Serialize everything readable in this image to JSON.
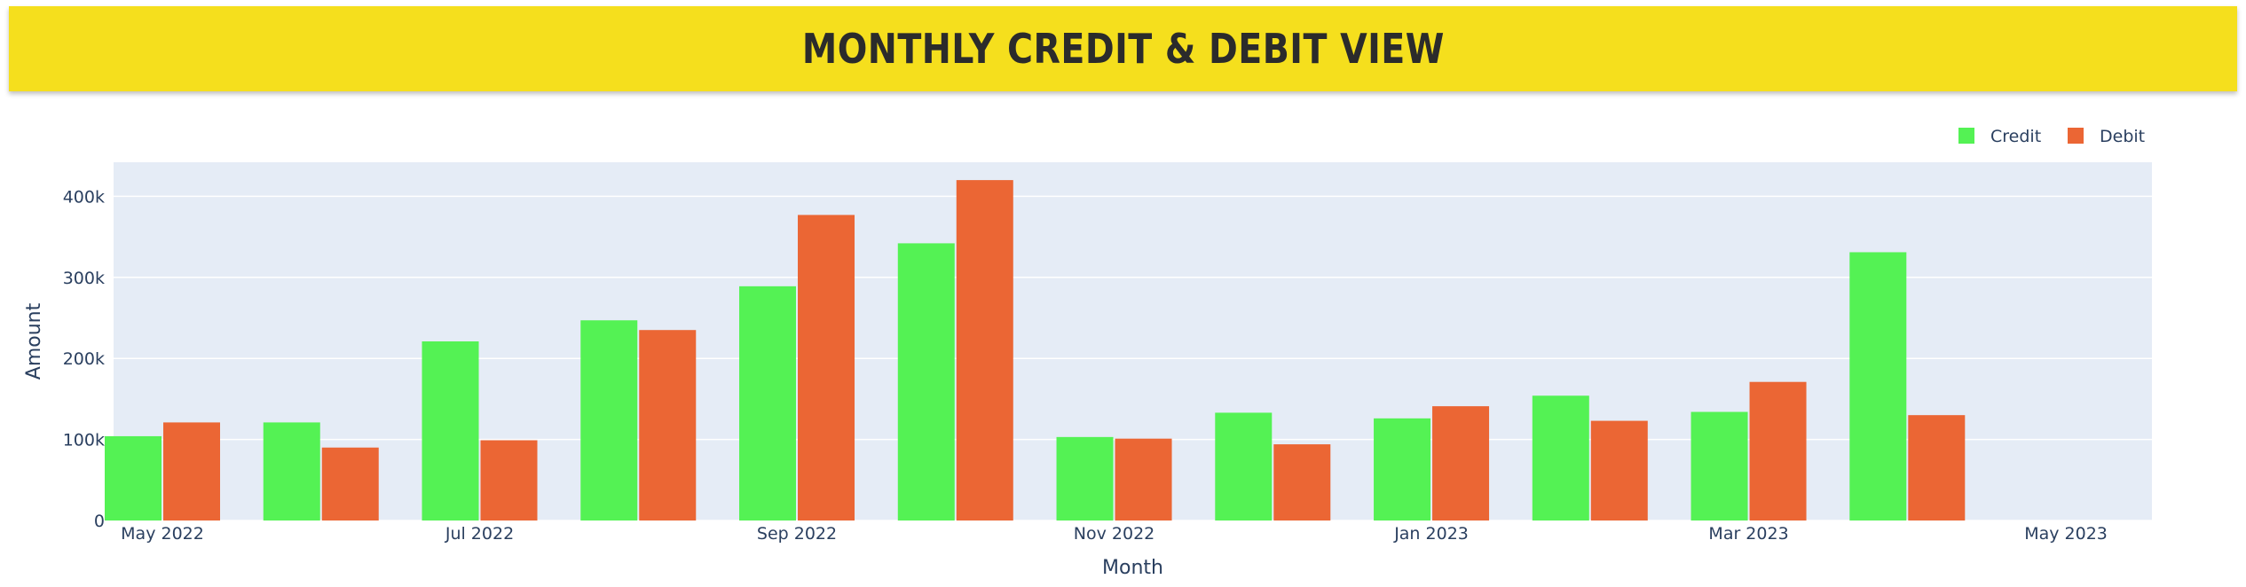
{
  "header": {
    "title": "MONTHLY CREDIT & DEBIT VIEW"
  },
  "colors": {
    "banner": "#f5df1d",
    "plot_bg": "#e5ecf6",
    "credit": "#54f254",
    "debit": "#eb6634",
    "text": "#2a3f5f"
  },
  "chart_data": {
    "type": "bar",
    "title": "MONTHLY CREDIT & DEBIT VIEW",
    "xlabel": "Month",
    "ylabel": "Amount",
    "categories": [
      "2022-05",
      "2022-06",
      "2022-07",
      "2022-08",
      "2022-09",
      "2022-10",
      "2022-11",
      "2022-12",
      "2023-01",
      "2023-02",
      "2023-03",
      "2023-04",
      "2023-05"
    ],
    "x_tick_labels": [
      {
        "category": "2022-05",
        "label": "May 2022"
      },
      {
        "category": "2022-07",
        "label": "Jul 2022"
      },
      {
        "category": "2022-09",
        "label": "Sep 2022"
      },
      {
        "category": "2022-11",
        "label": "Nov 2022"
      },
      {
        "category": "2023-01",
        "label": "Jan 2023"
      },
      {
        "category": "2023-03",
        "label": "Mar 2023"
      },
      {
        "category": "2023-05",
        "label": "May 2023"
      }
    ],
    "y_ticks": [
      {
        "value": 0,
        "label": "0"
      },
      {
        "value": 100000,
        "label": "100k"
      },
      {
        "value": 200000,
        "label": "200k"
      },
      {
        "value": 300000,
        "label": "300k"
      },
      {
        "value": 400000,
        "label": "400k"
      }
    ],
    "ylim": [
      0,
      442000
    ],
    "grid": true,
    "legend_position": "top-right",
    "series": [
      {
        "name": "Credit",
        "color": "#54f254",
        "values": [
          104000,
          121000,
          221000,
          247000,
          289000,
          342000,
          103000,
          133000,
          126000,
          154000,
          134000,
          331000,
          0
        ]
      },
      {
        "name": "Debit",
        "color": "#eb6634",
        "values": [
          121000,
          90000,
          99000,
          235000,
          377000,
          420000,
          101000,
          94000,
          141000,
          123000,
          171000,
          130000,
          0
        ]
      }
    ]
  }
}
